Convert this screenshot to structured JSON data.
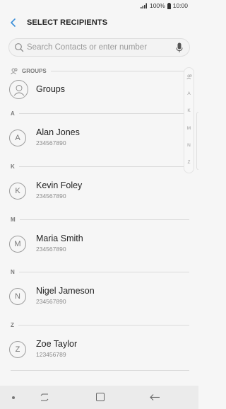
{
  "status_bar": {
    "battery": "100%",
    "time": "10:00"
  },
  "header": {
    "title": "SELECT RECIPIENTS"
  },
  "search": {
    "placeholder": "Search Contacts or enter number"
  },
  "groups_section": {
    "label": "GROUPS",
    "item_label": "Groups"
  },
  "contacts": [
    {
      "section": "A",
      "initial": "A",
      "name": "Alan Jones",
      "number": "234567890"
    },
    {
      "section": "K",
      "initial": "K",
      "name": "Kevin Foley",
      "number": "234567890"
    },
    {
      "section": "M",
      "initial": "M",
      "name": "Maria Smith",
      "number": "234567890"
    },
    {
      "section": "N",
      "initial": "N",
      "name": "Nigel Jameson",
      "number": "234567890"
    },
    {
      "section": "Z",
      "initial": "Z",
      "name": "Zoe Taylor",
      "number": "123456789"
    }
  ],
  "index_bar": {
    "items": [
      "A",
      "K",
      "M",
      "N",
      "Z"
    ]
  },
  "icons": {
    "back": "back-arrow-icon",
    "search": "search-icon",
    "mic": "mic-icon",
    "groups": "groups-icon",
    "index_groups": "groups-icon"
  },
  "colors": {
    "background": "#f6f6f6",
    "accent": "#3a8fd9",
    "nav_bar": "#ebebeb"
  }
}
